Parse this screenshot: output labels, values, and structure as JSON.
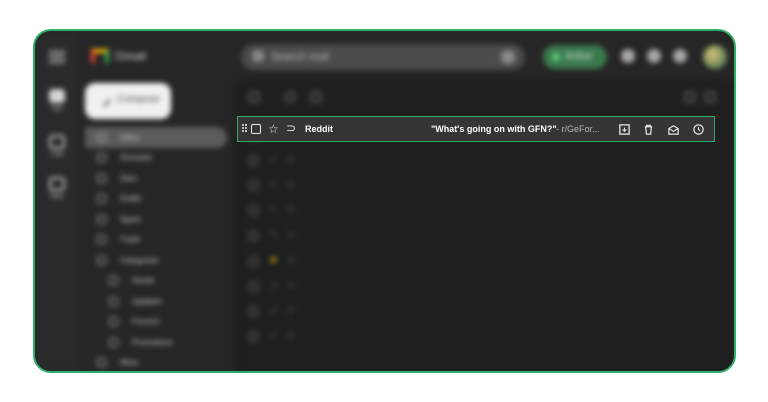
{
  "app": {
    "name": "Gmail"
  },
  "rail": [
    {
      "label": "Mail",
      "icon": "mail-icon",
      "active": true
    },
    {
      "label": "Chat",
      "icon": "chat-icon"
    },
    {
      "label": "Meet",
      "icon": "video-icon"
    }
  ],
  "search": {
    "placeholder": "Search mail"
  },
  "status": {
    "label": "Active"
  },
  "compose": {
    "label": "Compose"
  },
  "nav": [
    {
      "label": "Inbox",
      "count": "",
      "selected": true
    },
    {
      "label": "Snoozed",
      "count": ""
    },
    {
      "label": "Sent",
      "count": ""
    },
    {
      "label": "Drafts",
      "count": ""
    },
    {
      "label": "Spam",
      "count": ""
    },
    {
      "label": "Trash",
      "count": ""
    },
    {
      "label": "Categories",
      "count": ""
    },
    {
      "label": "Social",
      "count": ""
    },
    {
      "label": "Updates",
      "count": ""
    },
    {
      "label": "Forums",
      "count": ""
    },
    {
      "label": "Promotions",
      "count": ""
    },
    {
      "label": "More",
      "count": ""
    }
  ],
  "highlighted_email": {
    "sender": "Reddit",
    "subject": "\"What's going on with GFN?\"",
    "snippet": " - r/GeFor...",
    "actions": [
      "archive-icon",
      "trash-icon",
      "mark-unread-icon",
      "snooze-icon"
    ]
  },
  "emails": [
    {
      "sender": "",
      "subject": "",
      "snippet": "",
      "date": ""
    },
    {
      "sender": "",
      "subject": "",
      "snippet": "",
      "date": ""
    },
    {
      "sender": "",
      "subject": "",
      "snippet": "",
      "date": ""
    },
    {
      "sender": "",
      "subject": "",
      "snippet": "",
      "date": ""
    },
    {
      "sender": "",
      "subject": "",
      "snippet": "",
      "date": ""
    },
    {
      "sender": "",
      "subject": "",
      "snippet": "",
      "date": "",
      "starred": true
    },
    {
      "sender": "",
      "subject": "",
      "snippet": "",
      "date": ""
    },
    {
      "sender": "",
      "subject": "",
      "snippet": "",
      "date": ""
    },
    {
      "sender": "",
      "subject": "",
      "snippet": "",
      "date": ""
    }
  ],
  "colors": {
    "highlight_border": "#2fae68",
    "background": "#262626"
  }
}
